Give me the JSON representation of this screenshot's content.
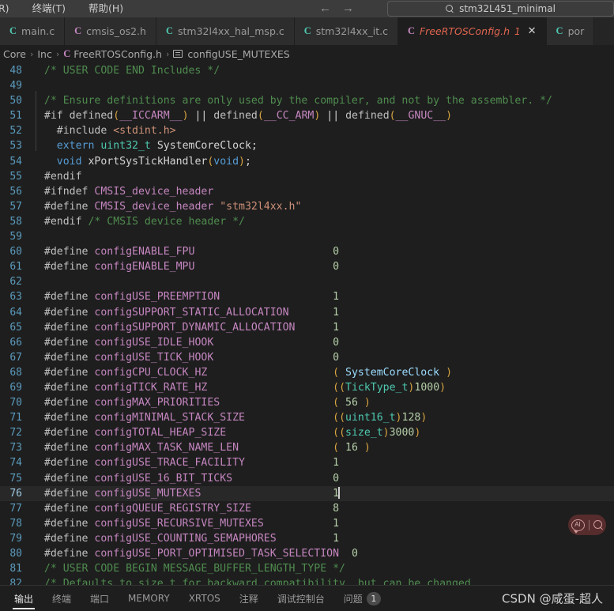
{
  "titlebar": {
    "menu_items": [
      "R)",
      "终端(T)",
      "帮助(H)"
    ],
    "back_arrow": "←",
    "forward_arrow": "→",
    "search_icon": "search-icon",
    "search_text": "stm32L451_minimal"
  },
  "tabs": [
    {
      "icon": "C",
      "icon_color": "#4ec9b0",
      "label": "main.c",
      "active": false,
      "badge": "",
      "close": ""
    },
    {
      "icon": "C",
      "icon_color": "#c586c0",
      "label": "cmsis_os2.h",
      "active": false,
      "badge": "",
      "close": ""
    },
    {
      "icon": "C",
      "icon_color": "#4ec9b0",
      "label": "stm32l4xx_hal_msp.c",
      "active": false,
      "badge": "",
      "close": ""
    },
    {
      "icon": "C",
      "icon_color": "#4ec9b0",
      "label": "stm32l4xx_it.c",
      "active": false,
      "badge": "",
      "close": ""
    },
    {
      "icon": "C",
      "icon_color": "#c586c0",
      "label": "FreeRTOSConfig.h",
      "active": true,
      "badge": "1",
      "close": "✕"
    },
    {
      "icon": "C",
      "icon_color": "#4ec9b0",
      "label": "por",
      "active": false,
      "badge": "",
      "close": ""
    }
  ],
  "breadcrumb": {
    "items": [
      "Core",
      "Inc",
      "FreeRTOSConfig.h",
      "configUSE_MUTEXES"
    ],
    "separator": "›",
    "file_icon": "C",
    "symbol_icon": "symbol-field-icon"
  },
  "editor": {
    "cursor_line": 76,
    "first_line": 48,
    "lines": [
      {
        "n": 48,
        "tokens": [
          {
            "t": "com",
            "s": "  /* USER CODE END Includes */"
          }
        ]
      },
      {
        "n": 49,
        "tokens": []
      },
      {
        "n": 50,
        "tokens": [
          {
            "t": "com",
            "s": "  /* Ensure definitions are only used by the compiler, and not by the assembler. */"
          }
        ]
      },
      {
        "n": 51,
        "tokens": [
          {
            "t": "pre",
            "s": "  #if defined"
          },
          {
            "t": "par",
            "s": "("
          },
          {
            "t": "mac",
            "s": "__ICCARM__"
          },
          {
            "t": "par",
            "s": ")"
          },
          {
            "t": "op",
            "s": " || "
          },
          {
            "t": "pre",
            "s": "defined"
          },
          {
            "t": "par",
            "s": "("
          },
          {
            "t": "mac",
            "s": "__CC_ARM"
          },
          {
            "t": "par",
            "s": ")"
          },
          {
            "t": "op",
            "s": " || "
          },
          {
            "t": "pre",
            "s": "defined"
          },
          {
            "t": "par",
            "s": "("
          },
          {
            "t": "mac",
            "s": "__GNUC__"
          },
          {
            "t": "par",
            "s": ")"
          }
        ]
      },
      {
        "n": 52,
        "tokens": [
          {
            "t": "pre",
            "s": "    #include "
          },
          {
            "t": "str",
            "s": "<stdint.h>"
          }
        ]
      },
      {
        "n": 53,
        "tokens": [
          {
            "t": "kw",
            "s": "    extern "
          },
          {
            "t": "typ",
            "s": "uint32_t "
          },
          {
            "t": "id",
            "s": "SystemCoreClock;"
          }
        ]
      },
      {
        "n": 54,
        "tokens": [
          {
            "t": "kw",
            "s": "    void "
          },
          {
            "t": "id",
            "s": "xPortSysTickHandler"
          },
          {
            "t": "par",
            "s": "("
          },
          {
            "t": "kw",
            "s": "void"
          },
          {
            "t": "par",
            "s": ")"
          },
          {
            "t": "id",
            "s": ";"
          }
        ]
      },
      {
        "n": 55,
        "tokens": [
          {
            "t": "pre",
            "s": "  #endif"
          }
        ]
      },
      {
        "n": 56,
        "tokens": [
          {
            "t": "pre",
            "s": "  #ifndef "
          },
          {
            "t": "mac",
            "s": "CMSIS_device_header"
          }
        ]
      },
      {
        "n": 57,
        "tokens": [
          {
            "t": "pre",
            "s": "  #define "
          },
          {
            "t": "mac",
            "s": "CMSIS_device_header "
          },
          {
            "t": "str",
            "s": "\"stm32l4xx.h\""
          }
        ]
      },
      {
        "n": 58,
        "tokens": [
          {
            "t": "pre",
            "s": "  #endif "
          },
          {
            "t": "com",
            "s": "/* CMSIS device header */"
          }
        ]
      },
      {
        "n": 59,
        "tokens": []
      },
      {
        "n": 60,
        "tokens": [
          {
            "t": "pre",
            "s": "  #define "
          },
          {
            "t": "mac",
            "s": "configENABLE_FPU"
          },
          {
            "t": "id",
            "s": "                      "
          },
          {
            "t": "num",
            "s": "0"
          }
        ]
      },
      {
        "n": 61,
        "tokens": [
          {
            "t": "pre",
            "s": "  #define "
          },
          {
            "t": "mac",
            "s": "configENABLE_MPU"
          },
          {
            "t": "id",
            "s": "                      "
          },
          {
            "t": "num",
            "s": "0"
          }
        ]
      },
      {
        "n": 62,
        "tokens": []
      },
      {
        "n": 63,
        "tokens": [
          {
            "t": "pre",
            "s": "  #define "
          },
          {
            "t": "mac",
            "s": "configUSE_PREEMPTION"
          },
          {
            "t": "id",
            "s": "                  "
          },
          {
            "t": "num",
            "s": "1"
          }
        ]
      },
      {
        "n": 64,
        "tokens": [
          {
            "t": "pre",
            "s": "  #define "
          },
          {
            "t": "mac",
            "s": "configSUPPORT_STATIC_ALLOCATION"
          },
          {
            "t": "id",
            "s": "       "
          },
          {
            "t": "num",
            "s": "1"
          }
        ]
      },
      {
        "n": 65,
        "tokens": [
          {
            "t": "pre",
            "s": "  #define "
          },
          {
            "t": "mac",
            "s": "configSUPPORT_DYNAMIC_ALLOCATION"
          },
          {
            "t": "id",
            "s": "      "
          },
          {
            "t": "num",
            "s": "1"
          }
        ]
      },
      {
        "n": 66,
        "tokens": [
          {
            "t": "pre",
            "s": "  #define "
          },
          {
            "t": "mac",
            "s": "configUSE_IDLE_HOOK"
          },
          {
            "t": "id",
            "s": "                   "
          },
          {
            "t": "num",
            "s": "0"
          }
        ]
      },
      {
        "n": 67,
        "tokens": [
          {
            "t": "pre",
            "s": "  #define "
          },
          {
            "t": "mac",
            "s": "configUSE_TICK_HOOK"
          },
          {
            "t": "id",
            "s": "                   "
          },
          {
            "t": "num",
            "s": "0"
          }
        ]
      },
      {
        "n": 68,
        "tokens": [
          {
            "t": "pre",
            "s": "  #define "
          },
          {
            "t": "mac",
            "s": "configCPU_CLOCK_HZ"
          },
          {
            "t": "id",
            "s": "                    "
          },
          {
            "t": "par",
            "s": "("
          },
          {
            "t": "var",
            "s": " SystemCoreClock "
          },
          {
            "t": "par",
            "s": ")"
          }
        ]
      },
      {
        "n": 69,
        "tokens": [
          {
            "t": "pre",
            "s": "  #define "
          },
          {
            "t": "mac",
            "s": "configTICK_RATE_HZ"
          },
          {
            "t": "id",
            "s": "                    "
          },
          {
            "t": "par",
            "s": "(("
          },
          {
            "t": "typ",
            "s": "TickType_t"
          },
          {
            "t": "par",
            "s": ")"
          },
          {
            "t": "num",
            "s": "1000"
          },
          {
            "t": "par",
            "s": ")"
          }
        ]
      },
      {
        "n": 70,
        "tokens": [
          {
            "t": "pre",
            "s": "  #define "
          },
          {
            "t": "mac",
            "s": "configMAX_PRIORITIES"
          },
          {
            "t": "id",
            "s": "                  "
          },
          {
            "t": "par",
            "s": "( "
          },
          {
            "t": "num",
            "s": "56"
          },
          {
            "t": "par",
            "s": " )"
          }
        ]
      },
      {
        "n": 71,
        "tokens": [
          {
            "t": "pre",
            "s": "  #define "
          },
          {
            "t": "mac",
            "s": "configMINIMAL_STACK_SIZE"
          },
          {
            "t": "id",
            "s": "              "
          },
          {
            "t": "par",
            "s": "(("
          },
          {
            "t": "typ",
            "s": "uint16_t"
          },
          {
            "t": "par",
            "s": ")"
          },
          {
            "t": "num",
            "s": "128"
          },
          {
            "t": "par",
            "s": ")"
          }
        ]
      },
      {
        "n": 72,
        "tokens": [
          {
            "t": "pre",
            "s": "  #define "
          },
          {
            "t": "mac",
            "s": "configTOTAL_HEAP_SIZE"
          },
          {
            "t": "id",
            "s": "                 "
          },
          {
            "t": "par",
            "s": "(("
          },
          {
            "t": "typ",
            "s": "size_t"
          },
          {
            "t": "par",
            "s": ")"
          },
          {
            "t": "num",
            "s": "3000"
          },
          {
            "t": "par",
            "s": ")"
          }
        ]
      },
      {
        "n": 73,
        "tokens": [
          {
            "t": "pre",
            "s": "  #define "
          },
          {
            "t": "mac",
            "s": "configMAX_TASK_NAME_LEN"
          },
          {
            "t": "id",
            "s": "               "
          },
          {
            "t": "par",
            "s": "( "
          },
          {
            "t": "num",
            "s": "16"
          },
          {
            "t": "par",
            "s": " )"
          }
        ]
      },
      {
        "n": 74,
        "tokens": [
          {
            "t": "pre",
            "s": "  #define "
          },
          {
            "t": "mac",
            "s": "configUSE_TRACE_FACILITY"
          },
          {
            "t": "id",
            "s": "              "
          },
          {
            "t": "num",
            "s": "1"
          }
        ]
      },
      {
        "n": 75,
        "tokens": [
          {
            "t": "pre",
            "s": "  #define "
          },
          {
            "t": "mac",
            "s": "configUSE_16_BIT_TICKS"
          },
          {
            "t": "id",
            "s": "                "
          },
          {
            "t": "num",
            "s": "0"
          }
        ]
      },
      {
        "n": 76,
        "tokens": [
          {
            "t": "pre",
            "s": "  #define "
          },
          {
            "t": "mac",
            "s": "configUSE_MUTEXES"
          },
          {
            "t": "id",
            "s": "                     "
          },
          {
            "t": "num",
            "s": "1"
          }
        ],
        "cursor": true
      },
      {
        "n": 77,
        "tokens": [
          {
            "t": "pre",
            "s": "  #define "
          },
          {
            "t": "mac",
            "s": "configQUEUE_REGISTRY_SIZE"
          },
          {
            "t": "id",
            "s": "             "
          },
          {
            "t": "num",
            "s": "8"
          }
        ]
      },
      {
        "n": 78,
        "tokens": [
          {
            "t": "pre",
            "s": "  #define "
          },
          {
            "t": "mac",
            "s": "configUSE_RECURSIVE_MUTEXES"
          },
          {
            "t": "id",
            "s": "           "
          },
          {
            "t": "num",
            "s": "1"
          }
        ]
      },
      {
        "n": 79,
        "tokens": [
          {
            "t": "pre",
            "s": "  #define "
          },
          {
            "t": "mac",
            "s": "configUSE_COUNTING_SEMAPHORES"
          },
          {
            "t": "id",
            "s": "         "
          },
          {
            "t": "num",
            "s": "1"
          }
        ]
      },
      {
        "n": 80,
        "tokens": [
          {
            "t": "pre",
            "s": "  #define "
          },
          {
            "t": "mac",
            "s": "configUSE_PORT_OPTIMISED_TASK_SELECTION"
          },
          {
            "t": "id",
            "s": "  "
          },
          {
            "t": "num",
            "s": "0"
          }
        ]
      },
      {
        "n": 81,
        "tokens": [
          {
            "t": "com",
            "s": "  /* USER CODE BEGIN MESSAGE_BUFFER_LENGTH_TYPE */"
          }
        ]
      },
      {
        "n": 82,
        "tokens": [
          {
            "t": "com",
            "s": "  /* Defaults to size_t for backward compatibility, but can be changed"
          }
        ]
      }
    ]
  },
  "ai_widget": {
    "label": "AI",
    "bubble_icon": "ai-chat-icon",
    "search_icon": "magnifier-icon"
  },
  "panel": {
    "tabs": [
      {
        "label": "输出",
        "active": true,
        "badge": ""
      },
      {
        "label": "终端",
        "active": false,
        "badge": ""
      },
      {
        "label": "端口",
        "active": false,
        "badge": ""
      },
      {
        "label": "MEMORY",
        "active": false,
        "badge": ""
      },
      {
        "label": "XRTOS",
        "active": false,
        "badge": ""
      },
      {
        "label": "注释",
        "active": false,
        "badge": ""
      },
      {
        "label": "调试控制台",
        "active": false,
        "badge": ""
      },
      {
        "label": "问题",
        "active": false,
        "badge": "1"
      }
    ],
    "watermark": "CSDN @咸蛋-超人"
  },
  "colors": {
    "editor_bg": "#1e1e1e",
    "tabbar_bg": "#252526",
    "titlebar_bg": "#3c3c3c",
    "accent_error": "#e0654f",
    "linenumber": "#5b9bbd",
    "comment": "#4f8c4f",
    "macro": "#c586c0",
    "number": "#b5cea8",
    "ai_widget_bg": "#5a2d2d"
  }
}
